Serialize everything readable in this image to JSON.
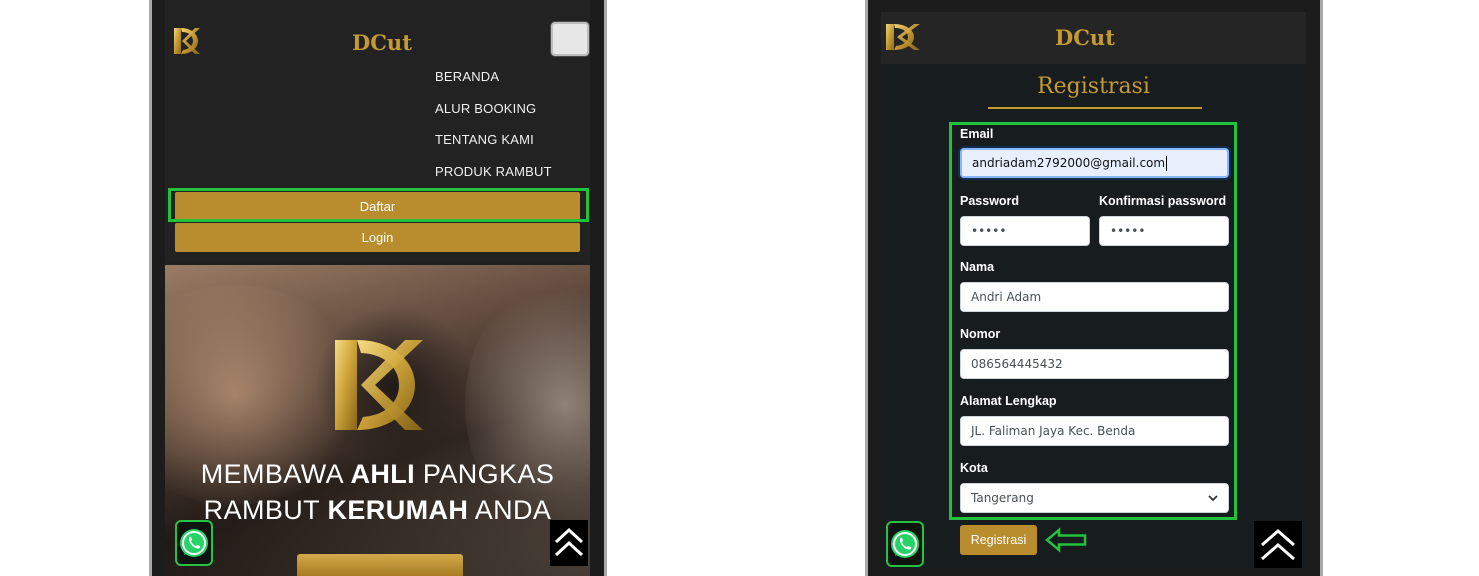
{
  "left": {
    "brand": "DCut",
    "menu": [
      "BERANDA",
      "ALUR BOOKING",
      "TENTANG KAMI",
      "PRODUK RAMBUT"
    ],
    "daftar_label": "Daftar",
    "login_label": "Login",
    "hero": {
      "line1_a": "MEMBAWA ",
      "line1_b": "AHLI",
      "line1_c": " PANGKAS",
      "line2_a": "RAMBUT ",
      "line2_b": "KERUMAH",
      "line2_c": " ANDA"
    }
  },
  "right": {
    "brand": "DCut",
    "title": "Registrasi",
    "form": {
      "email_label": "Email",
      "email_value": "andriadam2792000@gmail.com",
      "password_label": "Password",
      "password_value": "•••••",
      "confirm_label": "Konfirmasi password",
      "confirm_value": "•••••",
      "nama_label": "Nama",
      "nama_value": "Andri Adam",
      "nomor_label": "Nomor",
      "nomor_value": "086564445432",
      "alamat_label": "Alamat Lengkap",
      "alamat_value": "JL. Faliman Jaya Kec. Benda",
      "kota_label": "Kota",
      "kota_value": "Tangerang"
    },
    "submit_label": "Registrasi"
  },
  "colors": {
    "gold": "#c69a32",
    "button_gold": "#b98d2e",
    "highlight_green": "#22c33c",
    "whatsapp_green": "#25d366"
  },
  "icons": [
    "dcut-logo-icon",
    "whatsapp-icon",
    "chevron-up-icon",
    "arrow-left-icon"
  ]
}
